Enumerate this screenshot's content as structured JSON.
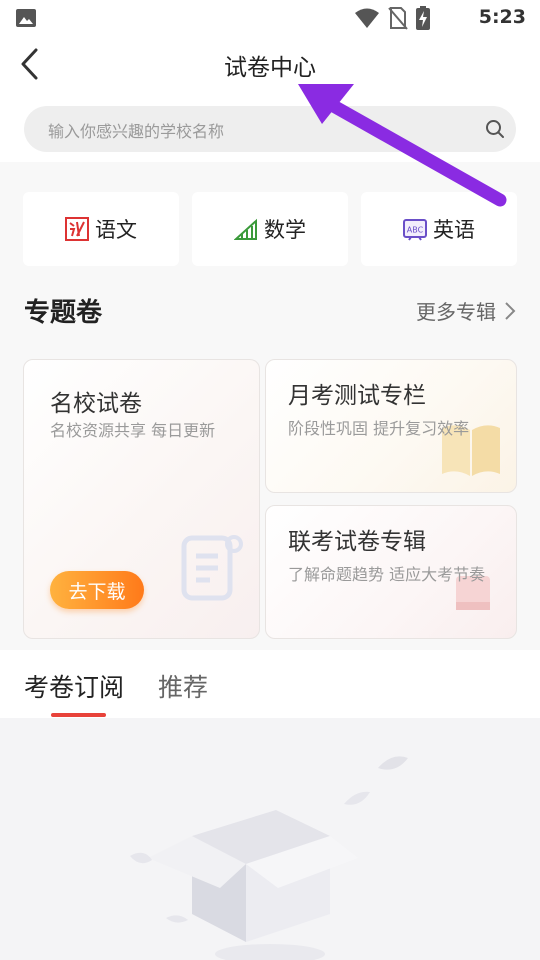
{
  "status_bar": {
    "time": "5:23"
  },
  "header": {
    "title": "试卷中心"
  },
  "search": {
    "placeholder": "输入你感兴趣的学校名称"
  },
  "subjects": [
    {
      "label": "语文",
      "icon": "chinese-subject-icon"
    },
    {
      "label": "数学",
      "icon": "math-subject-icon"
    },
    {
      "label": "英语",
      "icon": "english-abc-icon"
    }
  ],
  "section": {
    "title": "专题卷",
    "more_label": "更多专辑"
  },
  "cards": {
    "famous_school": {
      "title": "名校试卷",
      "subtitle": "名校资源共享 每日更新",
      "button": "去下载"
    },
    "monthly": {
      "title": "月考测试专栏",
      "subtitle": "阶段性巩固 提升复习效率"
    },
    "joint": {
      "title": "联考试卷专辑",
      "subtitle": "了解命题趋势 适应大考节奏"
    }
  },
  "tabs": [
    {
      "label": "考卷订阅",
      "active": true
    },
    {
      "label": "推荐",
      "active": false
    }
  ],
  "colors": {
    "accent": "#e8423a",
    "button_gradient_start": "#ffb23f",
    "button_gradient_end": "#ff7a1a",
    "annotation_arrow": "#8a2be2"
  }
}
